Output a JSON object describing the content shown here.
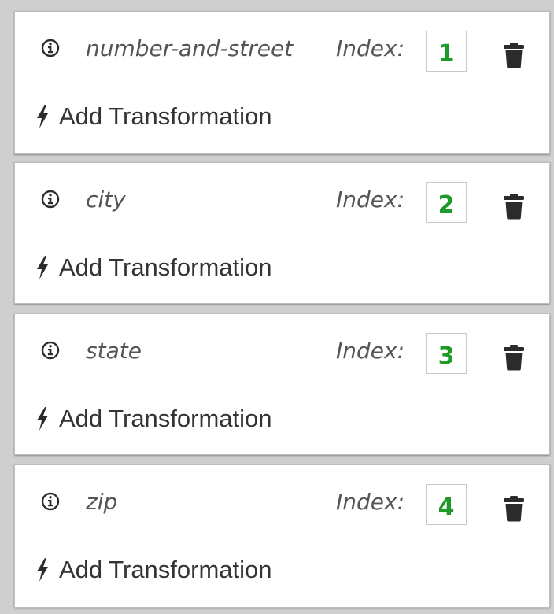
{
  "fields": [
    {
      "name": "number-and-street",
      "index_label": "Index:",
      "index": "1",
      "action": "Add Transformation"
    },
    {
      "name": "city",
      "index_label": "Index:",
      "index": "2",
      "action": "Add Transformation"
    },
    {
      "name": "state",
      "index_label": "Index:",
      "index": "3",
      "action": "Add Transformation"
    },
    {
      "name": "zip",
      "index_label": "Index:",
      "index": "4",
      "action": "Add Transformation"
    }
  ],
  "icons": {
    "info": "info-circle-icon",
    "delete": "trash-icon",
    "transform": "bolt-icon"
  },
  "colors": {
    "index_text": "#1e9a28",
    "icon": "#2b2b2b",
    "label": "#555555",
    "background": "#cfcfcf",
    "card": "#ffffff"
  }
}
